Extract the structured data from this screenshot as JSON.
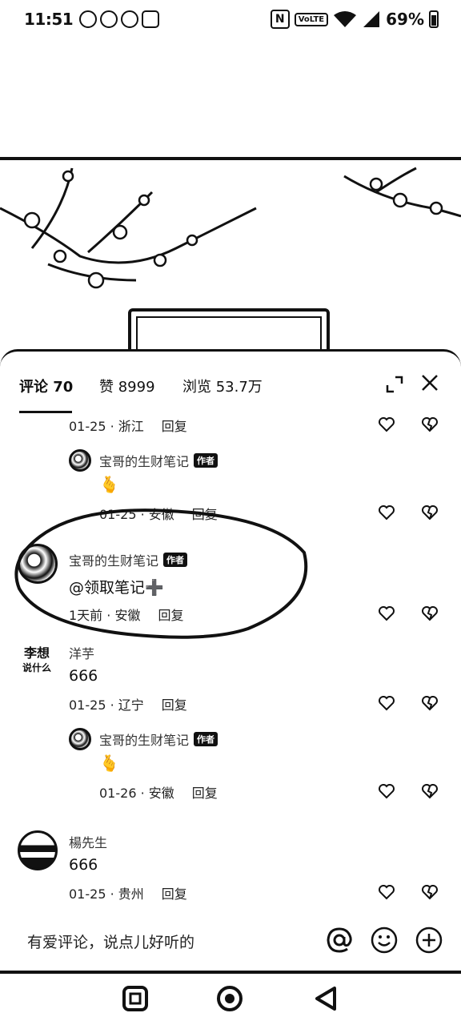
{
  "status": {
    "time": "11:51",
    "nfc": "N",
    "volte": "VoLTE",
    "battery": "69%"
  },
  "header": {
    "tab_comments": "评论 70",
    "tab_likes": "赞 8999",
    "tab_views": "浏览 53.7万"
  },
  "comments": [
    {
      "meta": "01-25 · 浙江",
      "reply": "回复"
    },
    {
      "name": "宝哥的生财笔记",
      "badge": "作者",
      "text": "🫰",
      "meta": "01-25 · 安徽",
      "reply": "回复"
    },
    {
      "name": "宝哥的生财笔记",
      "badge": "作者",
      "text": "@领取笔记➕",
      "meta": "1天前 · 安徽",
      "reply": "回复"
    },
    {
      "avatar_text": "李想",
      "avatar_subtext": "说什么",
      "name": "洋芋",
      "text": "666",
      "meta": "01-25 · 辽宁",
      "reply": "回复"
    },
    {
      "name": "宝哥的生财笔记",
      "badge": "作者",
      "text": "🫰",
      "meta": "01-26 · 安徽",
      "reply": "回复"
    },
    {
      "name": "楊先生",
      "text": "666",
      "meta": "01-25 · 贵州",
      "reply": "回复"
    }
  ],
  "input": {
    "placeholder": "有爱评论，说点儿好听的"
  }
}
